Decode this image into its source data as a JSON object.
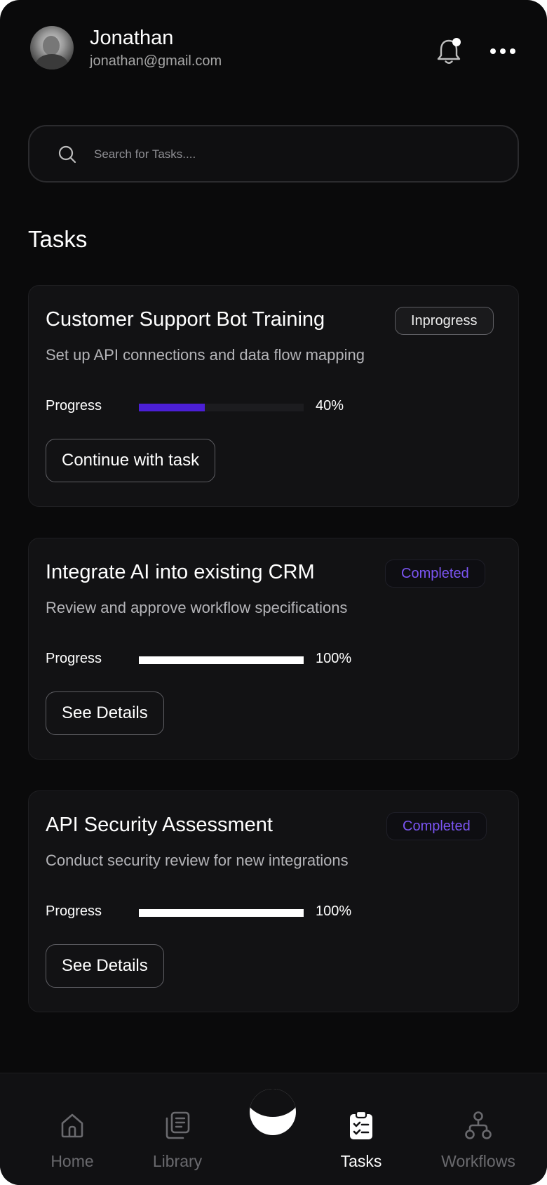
{
  "header": {
    "user_name": "Jonathan",
    "user_email": "jonathan@gmail.com"
  },
  "search": {
    "placeholder": "Search for Tasks....",
    "value": ""
  },
  "section_title": "Tasks",
  "tasks": [
    {
      "title": "Customer Support Bot Training",
      "status": "Inprogress",
      "description": "Set up API connections and data flow mapping",
      "progress_label": "Progress",
      "progress": 0.4,
      "progress_text": "40%",
      "button_label": "Continue with task"
    },
    {
      "title": "Integrate AI into existing CRM",
      "status": "Completed",
      "description": "Review and approve workflow specifications",
      "progress_label": "Progress",
      "progress": 1.0,
      "progress_text": "100%",
      "button_label": "See Details"
    },
    {
      "title": "API Security Assessment",
      "status": "Completed",
      "description": "Conduct security review for new integrations",
      "progress_label": "Progress",
      "progress": 1.0,
      "progress_text": "100%",
      "button_label": "See Details"
    }
  ],
  "nav": {
    "home": "Home",
    "library": "Library",
    "tasks": "Tasks",
    "workflows": "Workflows",
    "active": "tasks"
  },
  "colors": {
    "accent": "#4b1fd6",
    "completed_text": "#7b55f3",
    "progress_complete": "#ffffff",
    "background": "#0a0a0b",
    "card": "#121214"
  },
  "icons": {
    "notification": "bell-icon",
    "notification_dot": "notification-dot",
    "menu": "more-horizontal-icon",
    "search": "search-icon",
    "home": "home-icon",
    "library": "library-icon",
    "center": "app-logo-icon",
    "tasks": "clipboard-check-icon",
    "workflows": "workflow-icon"
  }
}
